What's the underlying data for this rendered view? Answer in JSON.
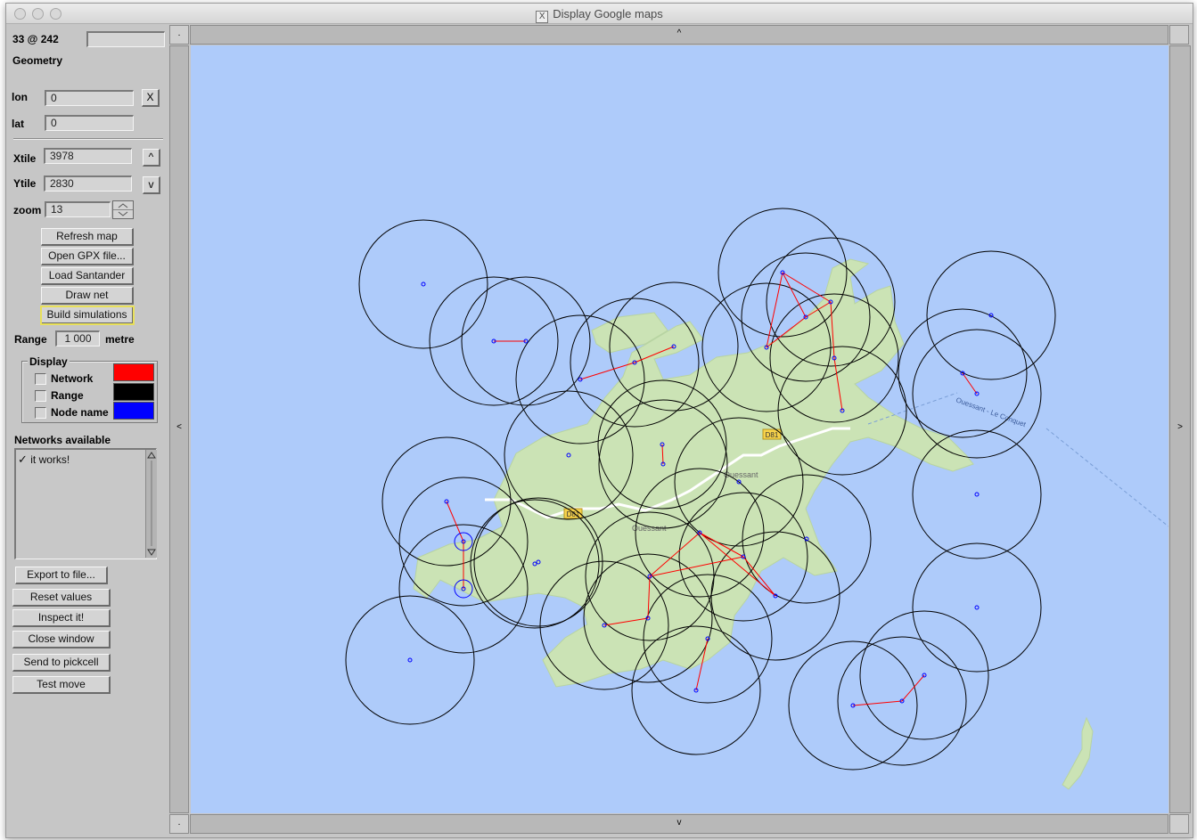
{
  "window": {
    "title": "Display Google maps"
  },
  "panel": {
    "coords_text": "33 @ 242",
    "coords_field": "",
    "geometry_label": "Geometry",
    "lon_label": "lon",
    "lon_value": "0",
    "clear_label": "X",
    "lat_label": "lat",
    "lat_value": "0",
    "xtile_label": "Xtile",
    "xtile_value": "3978",
    "up_label": "^",
    "ytile_label": "Ytile",
    "ytile_value": "2830",
    "down_label": "v",
    "zoom_label": "zoom",
    "zoom_value": "13",
    "buttons": {
      "refresh": "Refresh map",
      "open_gpx": "Open GPX file...",
      "load_santander": "Load Santander",
      "draw_net": "Draw net",
      "build_sim": "Build simulations"
    },
    "range_label": "Range",
    "range_value": "1 000",
    "range_unit": "metre",
    "display_group": "Display",
    "display_items": [
      {
        "label": "Network",
        "color": "#ff0000"
      },
      {
        "label": "Range",
        "color": "#000000"
      },
      {
        "label": "Node name",
        "color": "#0000ff"
      }
    ],
    "networks_label": "Networks available",
    "networks": [
      "it works!"
    ],
    "actions": {
      "export": "Export to file...",
      "reset": "Reset values",
      "inspect": "Inspect it!",
      "close": "Close window",
      "send": "Send to pickcell",
      "test": "Test move"
    }
  },
  "scroll": {
    "up": "^",
    "down": "v",
    "left": "<",
    "right": ">",
    "corner_tl": ".",
    "corner_bl": "."
  },
  "map": {
    "labels": {
      "road1": "D81",
      "road2": "D81",
      "town": "Ouessant",
      "place": "Ouessant",
      "ferry": "Ouessant - Le Conquet"
    },
    "colors": {
      "sea": "#aecbfa",
      "land": "#cbe3b5",
      "network": "#ff0000",
      "range": "#000000",
      "node": "#0000ff"
    }
  }
}
